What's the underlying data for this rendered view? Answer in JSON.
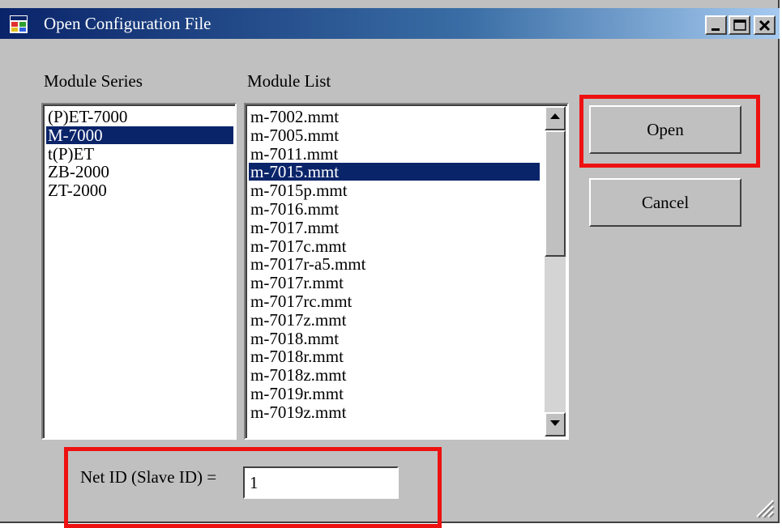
{
  "window": {
    "title": "Open Configuration File",
    "icon": "app-window-icon",
    "controls": [
      "minimize-icon",
      "maximize-icon",
      "close-icon"
    ]
  },
  "series": {
    "label": "Module Series",
    "items": [
      "(P)ET-7000",
      "M-7000",
      "t(P)ET",
      "ZB-2000",
      "ZT-2000"
    ],
    "selected_index": 1
  },
  "modules": {
    "label": "Module List",
    "items": [
      "m-7002.mmt",
      "m-7005.mmt",
      "m-7011.mmt",
      "m-7015.mmt",
      "m-7015p.mmt",
      "m-7016.mmt",
      "m-7017.mmt",
      "m-7017c.mmt",
      "m-7017r-a5.mmt",
      "m-7017r.mmt",
      "m-7017rc.mmt",
      "m-7017z.mmt",
      "m-7018.mmt",
      "m-7018r.mmt",
      "m-7018z.mmt",
      "m-7019r.mmt",
      "m-7019z.mmt"
    ],
    "selected_index": 3,
    "scroll_fraction": 0
  },
  "buttons": {
    "open_label": "Open",
    "cancel_label": "Cancel"
  },
  "net_id": {
    "label": "Net ID (Slave ID) =",
    "value": "1"
  },
  "colors": {
    "highlight": "#ee1111",
    "selection": "#0a246a",
    "title_gradient_start": "#0a246a",
    "title_gradient_end": "#a6caf0"
  }
}
